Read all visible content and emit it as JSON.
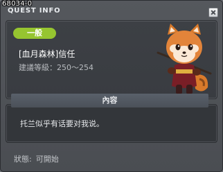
{
  "quest": {
    "id": "68034-0",
    "window_title": "QUEST INFO",
    "category": "一般",
    "name": "[血月森林]信任",
    "recommended_level": "建議等級：250～254",
    "content_header": "內容",
    "content_text": "托兰似乎有话要对我说。",
    "status_label": "狀態:",
    "status_value": "可開始"
  },
  "icons": {
    "close": "close-icon",
    "npc": "red-panda-npc-portrait"
  },
  "colors": {
    "category_badge": "#96c530",
    "window_bg": "#4a4d52",
    "panel_bg": "#3b3e43"
  }
}
